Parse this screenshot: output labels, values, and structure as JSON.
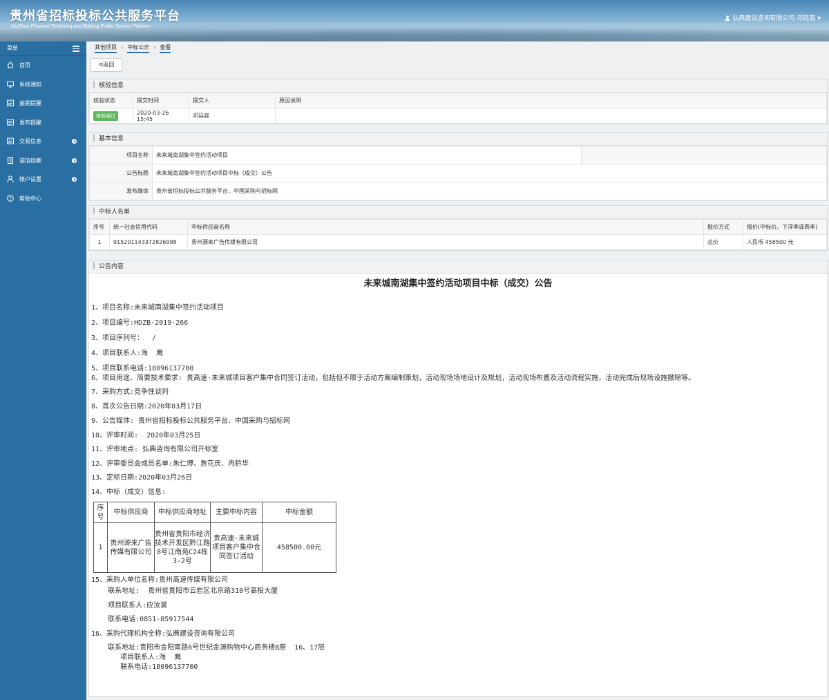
{
  "header": {
    "title": "贵州省招标投标公共服务平台",
    "subtitle": "GuiZhou Province Tendering and Bidding Public Service Platform",
    "user": "弘典建设咨询有限公司-邓廷容 ▾"
  },
  "sidebar": {
    "menu_label": "菜单",
    "items": [
      {
        "label": "首页",
        "icon": "home-icon",
        "arrow": false
      },
      {
        "label": "系统通知",
        "icon": "monitor-icon",
        "arrow": false
      },
      {
        "label": "逾期提醒",
        "icon": "list-icon",
        "arrow": false
      },
      {
        "label": "发布提醒",
        "icon": "list-icon",
        "arrow": false
      },
      {
        "label": "交易信息",
        "icon": "list-icon",
        "arrow": true
      },
      {
        "label": "诚信档案",
        "icon": "document-icon",
        "arrow": true
      },
      {
        "label": "帐户设置",
        "icon": "user-icon",
        "arrow": true
      },
      {
        "label": "帮助中心",
        "icon": "help-icon",
        "arrow": false
      }
    ]
  },
  "breadcrumb": [
    "其他项目",
    "中标公示",
    "查看"
  ],
  "back_label": "返回",
  "verify": {
    "title": "核验信息",
    "headers": [
      "核验状态",
      "提交时间",
      "提交人",
      "原因说明"
    ],
    "status": "核验通过",
    "time": "2020-03-26 15:45",
    "submitter": "邓廷容",
    "reason": ""
  },
  "basic": {
    "title": "基本信息",
    "rows": [
      {
        "label": "项目名称",
        "value": "未来城南湖集中签约活动项目"
      },
      {
        "label": "公告标题",
        "value": "未来城南湖集中签约活动项目中标（成交）公告"
      },
      {
        "label": "发布媒体",
        "value": "贵州省招标投标公共服务平台，中国采购与招标网"
      }
    ]
  },
  "winners": {
    "title": "中标人名单",
    "headers": [
      "序号",
      "统一社会信用代码",
      "中标供应商名称",
      "报价方式",
      "报价(中标价、下浮率或费率)"
    ],
    "row": [
      "1",
      "915201143372826998",
      "贵州源来广告传媒有限公司",
      "总价",
      "人民币 458500 元"
    ]
  },
  "notice": {
    "section_title": "公告内容",
    "title": "未来城南湖集中签约活动项目中标（成交）公告",
    "lines": [
      "1、项目名称:未来城南湖集中签约活动项目",
      "2、项目编号:HDZB-2019-266",
      "3、项目序列号：  /",
      "4、项目联系人:海  鹰",
      "5、项目联系电话:18096137700",
      "6、项目用途、简要技术要求: 贵高速·未来城项目客户集中合同签订活动，包括但不限于活动方案编制策划，活动现场场地设计及规划，活动现场布置及活动流程实施，活动完成后现场设施撤除等。",
      "7、采购方式:竞争性谈判",
      "8、首次公告日期:2020年03月17日",
      "9、公告媒体: 贵州省招标投标公共服务平台、中国采购与招标网",
      "10、评审时间:  2020年03月25日",
      "11、评审地点: 弘典咨询有限公司开标室",
      "12、评审委员会成员名单:朱仁博、詹花庆、冉黔华",
      "13、定标日期:2020年03月26日",
      "14、中标（成交）信息:"
    ],
    "table": {
      "headers": [
        "序号",
        "中标供应商",
        "中标供应商地址",
        "主要中标内容",
        "中标金额"
      ],
      "row": [
        "1",
        "贵州源来广告传媒有限公司",
        "贵州省贵阳市经济技术开发区黔江路8号江南苑C24栋3-2号",
        "贵高速·未来城项目客户集中合同签订活动",
        "458500.00元"
      ]
    },
    "after": [
      "15、采购人单位名称:贵州高速传媒有限公司",
      "    联系地址:  贵州省贵阳市云岩区北京路310号高投大厦",
      "    项目联系人:应汝裳",
      "    联系电话:0851-85917544",
      "16、采购代理机构全称:弘典建设咨询有限公司",
      "    联系地址:贵阳市金阳南路6号世纪金源购物中心商务楼B座  16、17层",
      "       项目联系人:海  鹰",
      "       联系电话:18096137700"
    ]
  }
}
